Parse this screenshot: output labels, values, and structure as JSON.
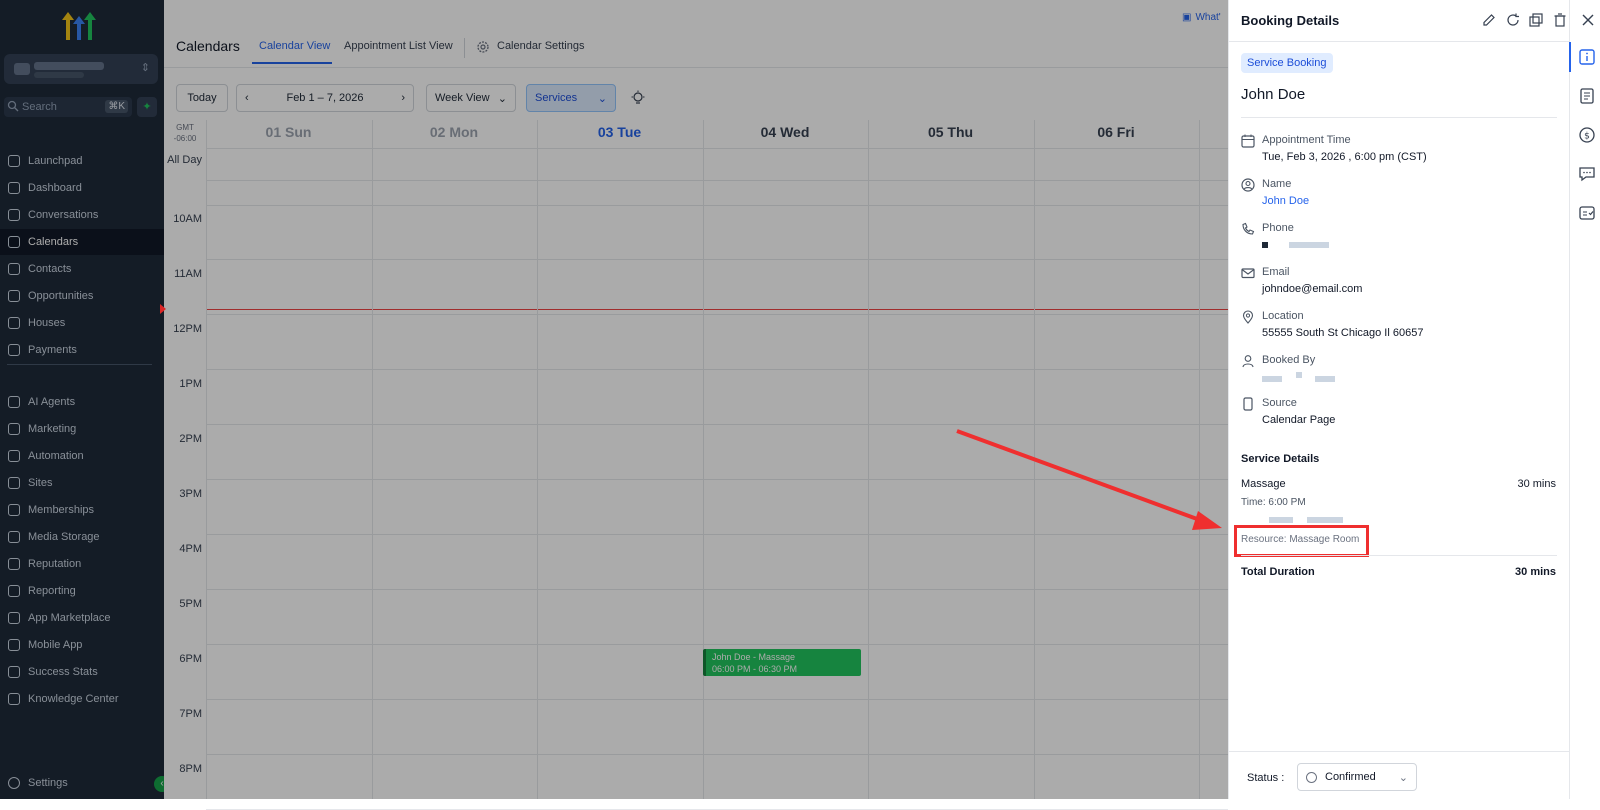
{
  "sidebar": {
    "search_placeholder": "Search",
    "search_shortcut": "⌘K",
    "items": [
      {
        "label": "Launchpad",
        "name": "sidebar-item-launchpad"
      },
      {
        "label": "Dashboard",
        "name": "sidebar-item-dashboard"
      },
      {
        "label": "Conversations",
        "name": "sidebar-item-conversations"
      },
      {
        "label": "Calendars",
        "name": "sidebar-item-calendars"
      },
      {
        "label": "Contacts",
        "name": "sidebar-item-contacts"
      },
      {
        "label": "Opportunities",
        "name": "sidebar-item-opportunities"
      },
      {
        "label": "Houses",
        "name": "sidebar-item-houses"
      },
      {
        "label": "Payments",
        "name": "sidebar-item-payments"
      },
      {
        "label": "AI Agents",
        "name": "sidebar-item-ai-agents"
      },
      {
        "label": "Marketing",
        "name": "sidebar-item-marketing"
      },
      {
        "label": "Automation",
        "name": "sidebar-item-automation"
      },
      {
        "label": "Sites",
        "name": "sidebar-item-sites"
      },
      {
        "label": "Memberships",
        "name": "sidebar-item-memberships"
      },
      {
        "label": "Media Storage",
        "name": "sidebar-item-media-storage"
      },
      {
        "label": "Reputation",
        "name": "sidebar-item-reputation"
      },
      {
        "label": "Reporting",
        "name": "sidebar-item-reporting"
      },
      {
        "label": "App Marketplace",
        "name": "sidebar-item-app-marketplace"
      },
      {
        "label": "Mobile App",
        "name": "sidebar-item-mobile-app"
      },
      {
        "label": "Success Stats",
        "name": "sidebar-item-success-stats"
      },
      {
        "label": "Knowledge Center",
        "name": "sidebar-item-knowledge-center"
      }
    ],
    "settings_label": "Settings"
  },
  "header": {
    "title": "Calendars",
    "tabs": [
      "Calendar View",
      "Appointment List View",
      "Calendar Settings"
    ],
    "whats_new": "What'"
  },
  "toolbar": {
    "today": "Today",
    "date_range": "Feb 1 – 7, 2026",
    "view": "Week View",
    "filter": "Services"
  },
  "calendar": {
    "gmt_line1": "GMT",
    "gmt_line2": "-06:00",
    "all_day": "All Day",
    "days": [
      "01 Sun",
      "02 Mon",
      "03 Tue",
      "04 Wed",
      "05 Thu",
      "06 Fri"
    ],
    "times": [
      "10AM",
      "11AM",
      "12PM",
      "1PM",
      "2PM",
      "3PM",
      "4PM",
      "5PM",
      "6PM",
      "7PM",
      "8PM"
    ],
    "event_title": "John Doe - Massage",
    "event_time": "06:00 PM - 06:30 PM"
  },
  "panel": {
    "title": "Booking Details",
    "badge": "Service Booking",
    "customer": "John Doe",
    "appointment_time_label": "Appointment Time",
    "appointment_time_value": "Tue, Feb 3, 2026 , 6:00 pm (CST)",
    "name_label": "Name",
    "name_value": "John Doe",
    "phone_label": "Phone",
    "email_label": "Email",
    "email_value": "johndoe@email.com",
    "location_label": "Location",
    "location_value": "55555 South St Chicago Il 60657",
    "booked_by_label": "Booked By",
    "source_label": "Source",
    "source_value": "Calendar Page",
    "service_details_title": "Service Details",
    "service_name": "Massage",
    "service_mins": "30 mins",
    "service_time": "Time: 6:00 PM",
    "service_resource": "Resource: Massage Room",
    "total_label": "Total Duration",
    "total_value": "30 mins",
    "status_label": "Status :",
    "status_value": "Confirmed"
  },
  "colors": {
    "accent": "#2563eb",
    "sidebar_bg": "#1f2a3a",
    "event_green": "#22c55e",
    "annotation_red": "#ef2f2f"
  }
}
